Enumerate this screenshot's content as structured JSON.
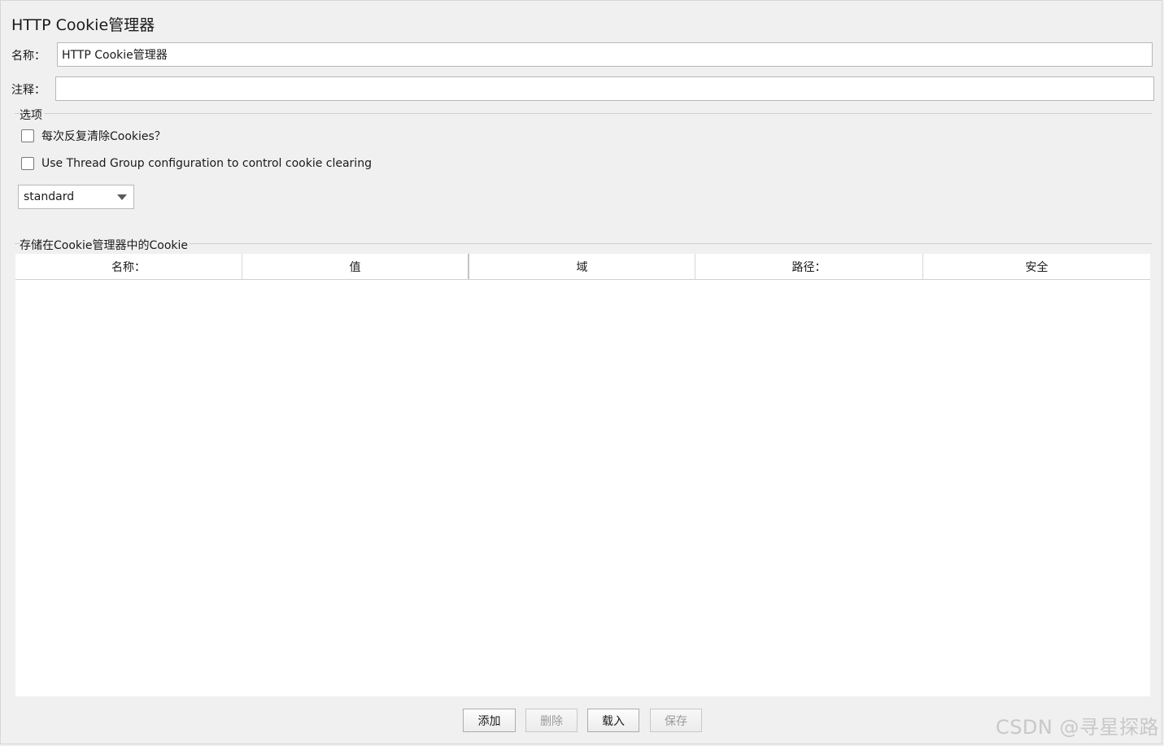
{
  "page": {
    "title": "HTTP Cookie管理器"
  },
  "form": {
    "name_label": "名称：",
    "name_value": "HTTP Cookie管理器",
    "comment_label": "注释：",
    "comment_value": ""
  },
  "options": {
    "group_title": "选项",
    "clear_each_iteration_label": "每次反复清除Cookies？",
    "clear_each_iteration_checked": false,
    "use_thread_group_label": "Use Thread Group configuration to control cookie clearing",
    "use_thread_group_checked": false,
    "cookie_policy_value": "standard"
  },
  "cookies": {
    "group_title": "存储在Cookie管理器中的Cookie",
    "columns": [
      "名称：",
      "值",
      "域",
      "路径：",
      "安全"
    ],
    "rows": []
  },
  "buttons": {
    "add_label": "添加",
    "delete_label": "删除",
    "load_label": "载入",
    "save_label": "保存"
  },
  "watermark": {
    "text": "CSDN @寻星探路"
  }
}
